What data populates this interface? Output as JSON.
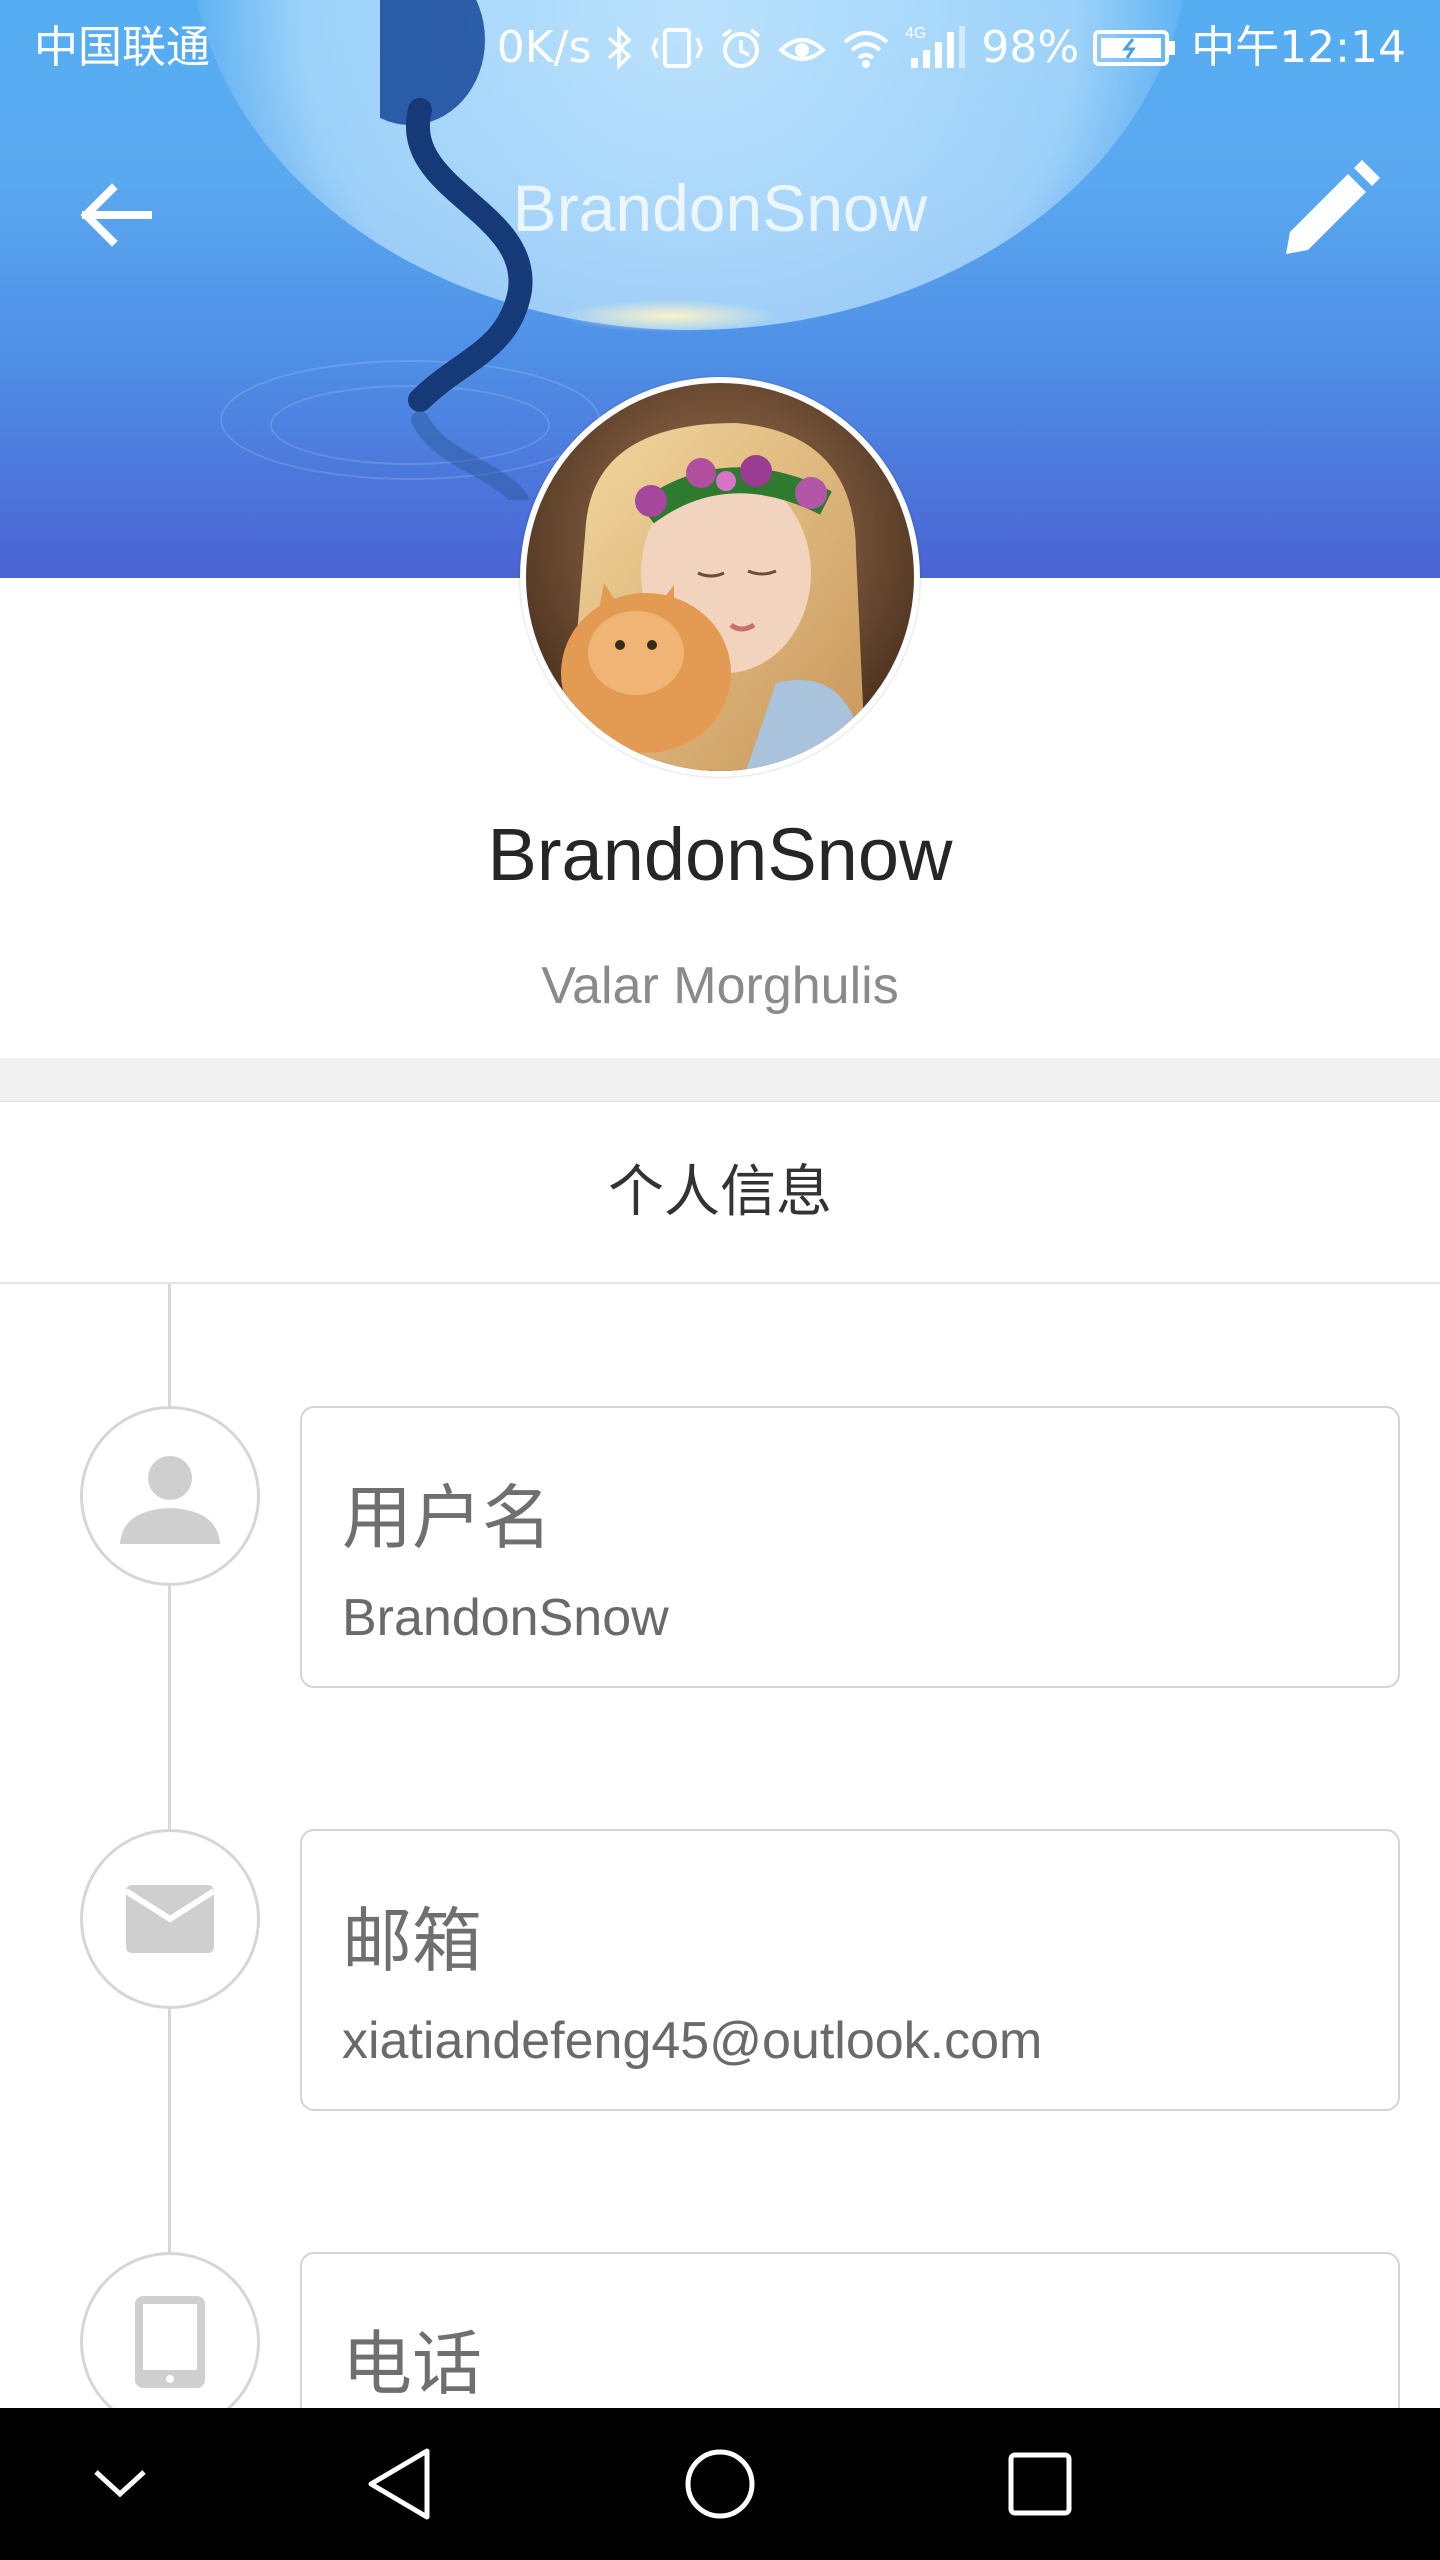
{
  "status_bar": {
    "carrier": "中国联通",
    "net_speed": "0K/s",
    "network_type": "4G",
    "battery": "98%",
    "time": "中午12:14"
  },
  "toolbar": {
    "title": "BrandonSnow",
    "back_icon": "arrow-left-icon",
    "edit_icon": "pencil-icon"
  },
  "profile": {
    "name": "BrandonSnow",
    "motto": "Valar Morghulis"
  },
  "section": {
    "title": "个人信息"
  },
  "info": [
    {
      "icon": "person-icon",
      "label": "用户名",
      "value": "BrandonSnow"
    },
    {
      "icon": "mail-icon",
      "label": "邮箱",
      "value": "xiatiandefeng45@outlook.com"
    },
    {
      "icon": "phone-icon",
      "label": "电话",
      "value": ""
    }
  ],
  "colors": {
    "banner_top": "#56aef2",
    "banner_bottom": "#4a63d2",
    "text_primary": "#262626",
    "text_secondary": "#8a8a8a"
  }
}
